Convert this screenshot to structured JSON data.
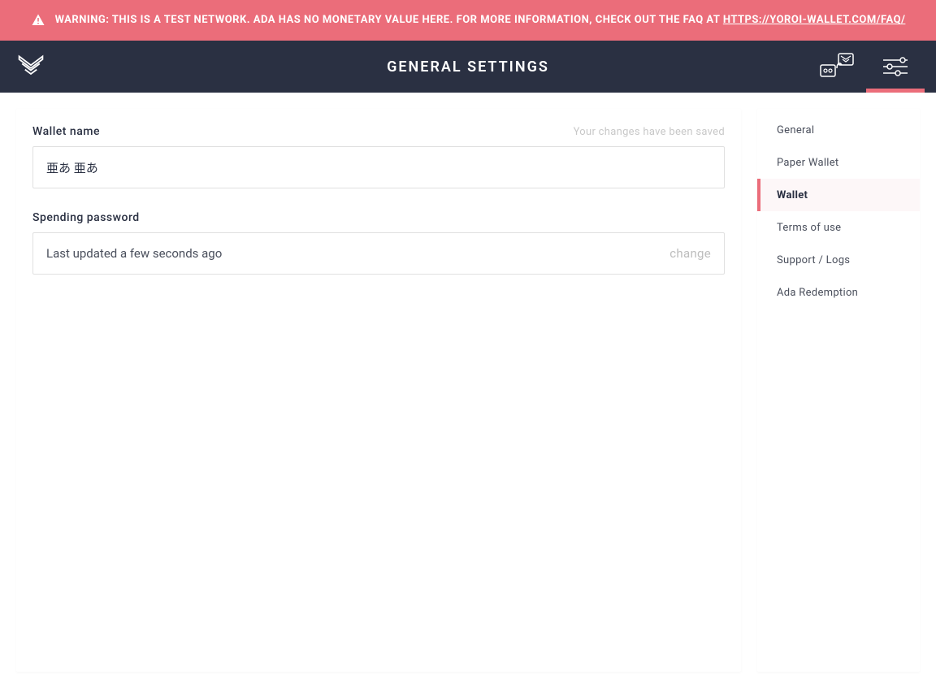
{
  "warning": {
    "prefix": "WARNING: THIS IS A TEST NETWORK. ADA HAS NO MONETARY VALUE HERE. FOR MORE INFORMATION, CHECK OUT THE FAQ AT ",
    "link_text": "HTTPS://YOROI-WALLET.COM/FAQ/"
  },
  "header": {
    "title": "GENERAL SETTINGS"
  },
  "main": {
    "wallet_name_label": "Wallet name",
    "wallet_name_value": "亜あ 亜あ",
    "saved_status": "Your changes have been saved",
    "spending_password_label": "Spending password",
    "spending_password_status": "Last updated a few seconds ago",
    "change_label": "change"
  },
  "sidebar": {
    "items": [
      {
        "label": "General",
        "active": false
      },
      {
        "label": "Paper Wallet",
        "active": false
      },
      {
        "label": "Wallet",
        "active": true
      },
      {
        "label": "Terms of use",
        "active": false
      },
      {
        "label": "Support / Logs",
        "active": false
      },
      {
        "label": "Ada Redemption",
        "active": false
      }
    ]
  },
  "colors": {
    "accent": "#EB6D7A",
    "header_bg": "#2A3042"
  }
}
